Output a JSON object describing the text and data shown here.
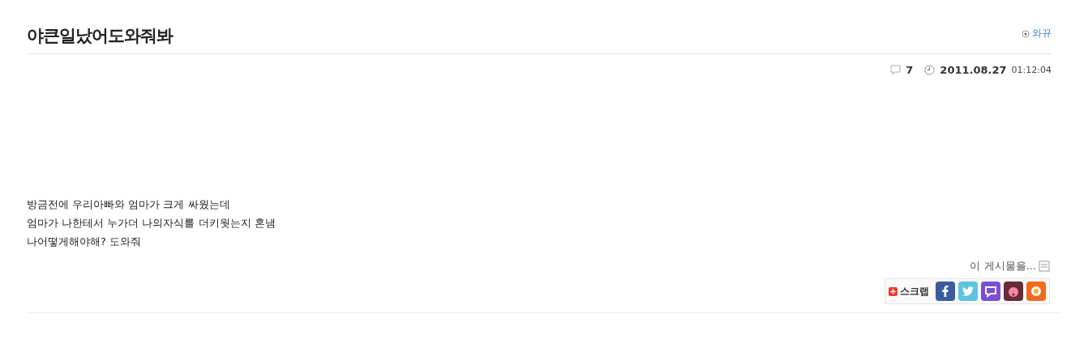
{
  "post": {
    "title": "야큰일났어도와줘봐",
    "author": "와뀨",
    "comment_count": "7",
    "date": "2011.08.27",
    "time": "01:12:04",
    "body": [
      "방금전에 우리아빠와 엄마가 크게 싸웠는데",
      "엄마가 나한테서 누가더 나의자식를 더키웟는지 혼냄",
      "나어떻게해야해? 도와줘"
    ]
  },
  "share": {
    "label": "이 게시물을...",
    "scrap": "스크랩",
    "services": [
      {
        "kind": "facebook"
      },
      {
        "kind": "twitter"
      },
      {
        "kind": "talk"
      },
      {
        "kind": "character"
      },
      {
        "kind": "flower"
      }
    ]
  }
}
